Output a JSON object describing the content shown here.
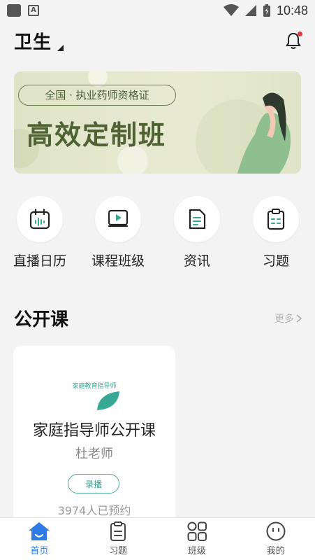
{
  "status_bar": {
    "time": "10:48",
    "notification_icons": [
      "app-square-icon",
      "a-icon"
    ],
    "status_icons": [
      "wifi-icon",
      "signal-icon",
      "battery-icon"
    ]
  },
  "header": {
    "city": "卫生",
    "bell_icon": "bell-icon",
    "has_notification": true
  },
  "banner": {
    "pill_text": "全国 · 执业药师资格证",
    "title": "高效定制班"
  },
  "quick_entries": [
    {
      "label": "直播日历",
      "icon": "calendar-icon"
    },
    {
      "label": "课程班级",
      "icon": "course-play-icon"
    },
    {
      "label": "资讯",
      "icon": "document-icon"
    },
    {
      "label": "习题",
      "icon": "clipboard-icon"
    }
  ],
  "public_course": {
    "title": "公开课",
    "more": "更多",
    "card": {
      "tag": "家庭教育指导师",
      "title": "家庭指导师公开课",
      "teacher": "杜老师",
      "button": "录播",
      "count": "3974人已预约"
    }
  },
  "tabbar": [
    {
      "label": "首页",
      "icon": "home-icon",
      "active": true
    },
    {
      "label": "习题",
      "icon": "exercise-icon",
      "active": false
    },
    {
      "label": "班级",
      "icon": "class-grid-icon",
      "active": false
    },
    {
      "label": "我的",
      "icon": "profile-icon",
      "active": false
    }
  ],
  "colors": {
    "accent": "#2f7ae5",
    "teal": "#3aa693",
    "banner_green": "#4f6233",
    "background": "#f3f3f4"
  }
}
